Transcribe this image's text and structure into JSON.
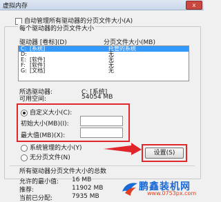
{
  "window": {
    "title": "虚拟内存",
    "close_label": "x"
  },
  "auto_manage": {
    "label": "自动管理所有驱动器的分页文件大小(A)",
    "checked": false
  },
  "group_label": "每个驱动器的分页文件大小",
  "list": {
    "header_drive": "驱动器 [卷标](D)",
    "header_size": "分页文件大小(MB)",
    "rows": [
      {
        "drive": "C:",
        "label": "[系统]",
        "size": "托管的系统",
        "selected": true
      },
      {
        "drive": "D:",
        "label": "",
        "size": "无",
        "selected": false
      },
      {
        "drive": "E:",
        "label": "[软件]",
        "size": "无",
        "selected": false
      },
      {
        "drive": "F:",
        "label": "[软件]",
        "size": "无",
        "selected": false
      },
      {
        "drive": "G:",
        "label": "[文档]",
        "size": "无",
        "selected": false
      }
    ]
  },
  "selected_drive": {
    "label": "所选驱动器:",
    "value": "C:  [系统]"
  },
  "free_space": {
    "label": "可用空间:",
    "value": "54054 MB"
  },
  "custom_size": {
    "label": "自定义大小(C):",
    "selected": true
  },
  "initial_size": {
    "label": "初始大小(MB)(I):",
    "value": ""
  },
  "max_size": {
    "label": "最大值(MB)(X):",
    "value": ""
  },
  "system_managed": {
    "label": "系统管理的大小(Y)"
  },
  "no_paging": {
    "label": "无分页文件(N)"
  },
  "set_button": "设置(S)",
  "totals": {
    "heading": "所有驱动器分页文件大小的总数",
    "min_label": "允许的最小值:",
    "min_value": "16 MB",
    "rec_label": "推荐:",
    "rec_value": "11902 MB",
    "cur_label": "当前已分配:",
    "cur_value": "7935 MB"
  },
  "watermark": {
    "name": "鹏鑫装机网",
    "url": "www.0753px.com"
  },
  "colors": {
    "highlight": "#e0262b",
    "selection": "#3399ff"
  }
}
